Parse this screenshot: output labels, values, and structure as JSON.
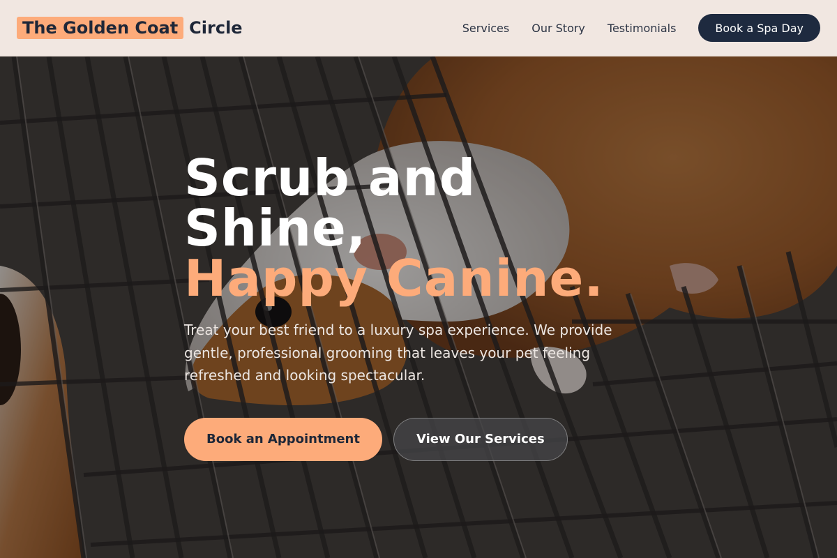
{
  "brand": {
    "highlight": "The Golden Coat",
    "rest": "Circle"
  },
  "nav": {
    "links": [
      "Services",
      "Our Story",
      "Testimonials"
    ],
    "cta": "Book a Spa Day"
  },
  "hero": {
    "headline_line1": "Scrub and",
    "headline_line2": "Shine,",
    "headline_accent": "Happy Canine.",
    "lead": "Treat your best friend to a luxury spa experience. We provide gentle, professional grooming that leaves your pet feeling refreshed and looking spectacular.",
    "primary_cta": "Book an Appointment",
    "secondary_cta": "View Our Services",
    "image_subject": "guinea pig on metal grate"
  },
  "colors": {
    "accent": "#fdab7a",
    "navy": "#1e2a3f",
    "header_bg": "#f1e7e1"
  }
}
